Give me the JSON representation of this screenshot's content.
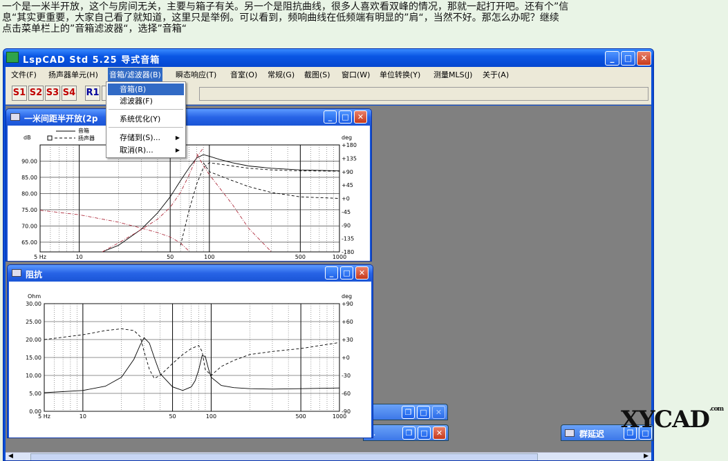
{
  "article": {
    "line1": "一个是一米半开放，这个与房间无关，主要与箱子有关。另一个是阻抗曲线，很多人喜欢看双峰的情况，那就一起打开吧。还有个”信",
    "line2": "息“其实更重要，大家自己看了就知道，这里只是举例。可以看到，频响曲线在低频端有明显的”肩“，当然不好。那怎么办呢？继续",
    "line3": "点击菜单栏上的”音箱滤波器“，选择”音箱“"
  },
  "app": {
    "title": "LspCAD Std 5.25 导式音箱",
    "controls": {
      "minimize": "_",
      "maximize": "□",
      "close": "✕"
    }
  },
  "menubar": [
    "文件(F)",
    "扬声器单元(H)",
    "音箱/滤波器(B)",
    "瞬态响应(T)",
    "音室(O)",
    "常规(G)",
    "截图(S)",
    "窗口(W)",
    "单位转换(Y)",
    "测量MLS(J)",
    "关于(A)"
  ],
  "toolbar": {
    "buttons": [
      "S1",
      "S2",
      "S3",
      "S4",
      "R1",
      "R"
    ]
  },
  "dropdown": {
    "items": [
      "音箱(B)",
      "滤波器(F)",
      "系统优化(Y)",
      "存储到(S)...",
      "取消(R)..."
    ]
  },
  "freq_window": {
    "title": "一米间距半开放(2p",
    "legend": [
      "音箱",
      "扬声器"
    ],
    "y_unit": "dB",
    "y2_unit": "deg"
  },
  "imp_window": {
    "title": "阻抗",
    "y_unit": "Ohm",
    "y2_unit": "deg"
  },
  "taskbar": {
    "item1": "...",
    "item2": "群延迟"
  },
  "watermark": {
    "text": "XYCAD",
    "suffix": ".com"
  },
  "chart_data": [
    {
      "type": "line",
      "title": "一米间距半开放(2p",
      "xlabel": "",
      "ylabel": "dB",
      "y2label": "deg",
      "x_scale": "log",
      "xlim": [
        5,
        1000
      ],
      "xticks": [
        "5 Hz",
        "10",
        "50",
        "100",
        "500",
        "1000"
      ],
      "ylim": [
        62,
        95
      ],
      "yticks": [
        "65.00",
        "70.00",
        "75.00",
        "80.00",
        "85.00",
        "90.00"
      ],
      "y2lim": [
        -180,
        180
      ],
      "y2ticks": [
        "-180",
        "-135",
        "-90",
        "-45",
        "+0",
        "+45",
        "+90",
        "+135",
        "+180"
      ],
      "legend_position": "top-left",
      "grid": true,
      "series": [
        {
          "name": "音箱",
          "axis": "y",
          "style": "solid",
          "x": [
            15,
            20,
            30,
            40,
            50,
            60,
            70,
            80,
            90,
            100,
            120,
            150,
            200,
            300,
            500,
            1000
          ],
          "y": [
            62,
            64,
            69,
            74,
            79,
            84,
            88,
            91,
            92,
            91.5,
            90.5,
            89.5,
            88.5,
            87.8,
            87.3,
            87.0
          ]
        },
        {
          "name": "扬声器",
          "axis": "y",
          "style": "dashed",
          "x": [
            60,
            70,
            80,
            90,
            100,
            150,
            200,
            300,
            500,
            1000
          ],
          "y": [
            64,
            75,
            83,
            88,
            89.5,
            88.5,
            87.8,
            87.3,
            87.0,
            86.9
          ]
        },
        {
          "name": "",
          "axis": "y2",
          "style": "dash-dot",
          "x": [
            5,
            10,
            20,
            30,
            40,
            50,
            60,
            70
          ],
          "y": [
            -40,
            -55,
            -80,
            -100,
            -115,
            -130,
            -150,
            -178
          ]
        },
        {
          "name": "",
          "axis": "y2",
          "style": "dash-dot",
          "x": [
            15,
            20,
            30,
            40,
            50,
            60,
            70,
            80,
            90
          ],
          "y": [
            -180,
            -150,
            -105,
            -70,
            -30,
            20,
            80,
            140,
            170
          ]
        },
        {
          "name": "",
          "axis": "y2",
          "style": "dashed",
          "x": [
            90,
            100,
            150,
            200,
            300,
            500,
            1000
          ],
          "y": [
            120,
            90,
            60,
            40,
            20,
            5,
            0
          ]
        },
        {
          "name": "",
          "axis": "y2",
          "style": "dash-dot",
          "x": [
            80,
            90,
            100,
            150,
            200,
            300
          ],
          "y": [
            150,
            110,
            80,
            -20,
            -100,
            -180
          ]
        }
      ]
    },
    {
      "type": "line",
      "title": "阻抗",
      "xlabel": "",
      "ylabel": "Ohm",
      "y2label": "deg",
      "x_scale": "log",
      "xlim": [
        5,
        1000
      ],
      "xticks": [
        "5 Hz",
        "10",
        "50",
        "100",
        "500",
        "1000"
      ],
      "ylim": [
        0,
        30
      ],
      "yticks": [
        "0.00",
        "5.00",
        "10.00",
        "15.00",
        "20.00",
        "25.00",
        "30.00"
      ],
      "y2lim": [
        -90,
        90
      ],
      "y2ticks": [
        "-90",
        "-60",
        "-30",
        "+0",
        "+30",
        "+60",
        "+90"
      ],
      "grid": true,
      "series": [
        {
          "name": "",
          "axis": "y",
          "style": "solid",
          "x": [
            5,
            10,
            15,
            20,
            25,
            28,
            30,
            33,
            36,
            40,
            50,
            60,
            70,
            75,
            80,
            85,
            90,
            95,
            100,
            120,
            150,
            200,
            300,
            500,
            1000
          ],
          "y": [
            5.2,
            5.8,
            7.0,
            9.5,
            14.5,
            18.5,
            20.5,
            19.0,
            15.0,
            10.5,
            6.8,
            5.8,
            6.8,
            8.5,
            11.5,
            15.5,
            15.3,
            12.0,
            9.5,
            7.2,
            6.6,
            6.3,
            6.2,
            6.3,
            6.5
          ]
        },
        {
          "name": "",
          "axis": "y2",
          "style": "dashed",
          "x": [
            5,
            10,
            15,
            20,
            25,
            28,
            30,
            33,
            36,
            40,
            50,
            60,
            70,
            80,
            85,
            90,
            100,
            120,
            150,
            200,
            300,
            500,
            1000
          ],
          "y": [
            30,
            38,
            45,
            48,
            45,
            35,
            10,
            -20,
            -35,
            -30,
            -10,
            5,
            15,
            20,
            10,
            -20,
            -30,
            -15,
            -5,
            5,
            10,
            15,
            25
          ]
        }
      ]
    }
  ]
}
